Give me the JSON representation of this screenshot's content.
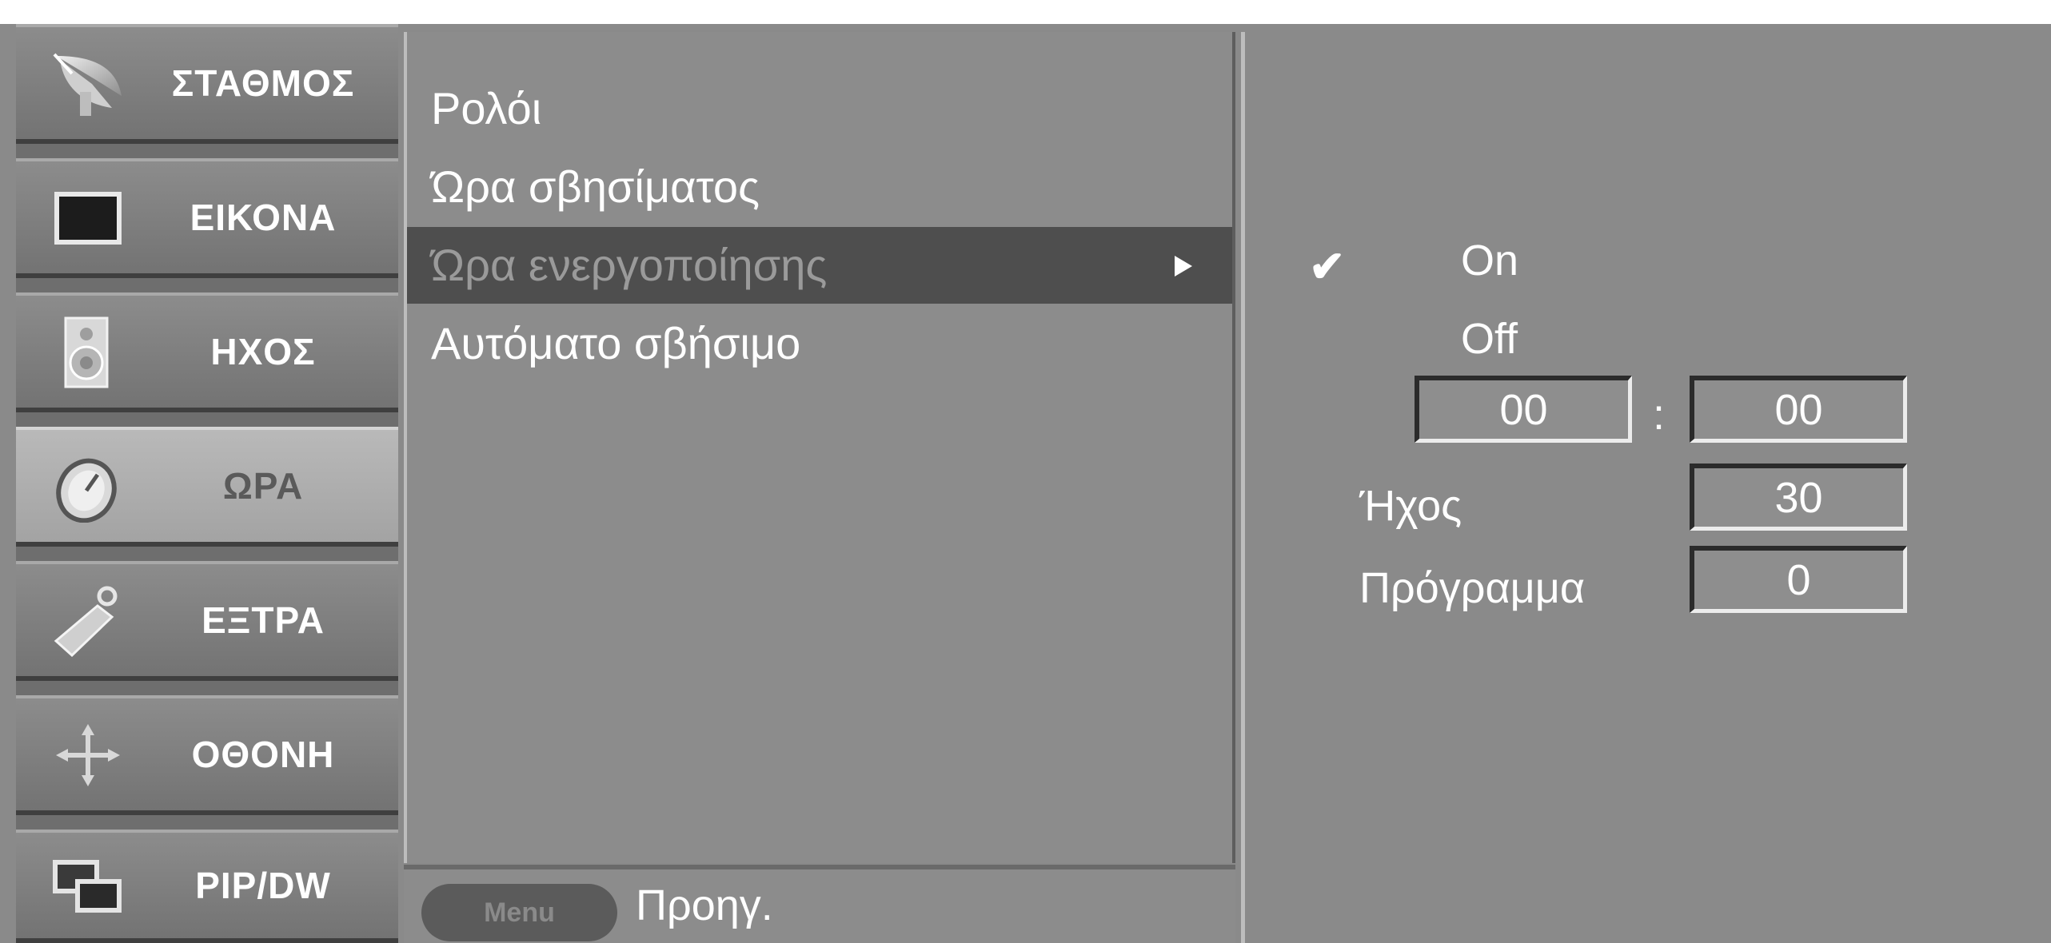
{
  "categories": [
    {
      "label": "ΣΤΑΘΜΟΣ",
      "icon": "satellite-dish-icon"
    },
    {
      "label": "ΕΙΚΟΝΑ",
      "icon": "screen-icon"
    },
    {
      "label": "ΗΧΟΣ",
      "icon": "speaker-icon"
    },
    {
      "label": "ΩΡΑ",
      "icon": "clock-icon"
    },
    {
      "label": "ΕΞΤΡΑ",
      "icon": "key-tag-icon"
    },
    {
      "label": "ΟΘΟΝΗ",
      "icon": "move-arrows-icon"
    },
    {
      "label": "PIP/DW",
      "icon": "pip-windows-icon"
    }
  ],
  "active_category": "ΩΡΑ",
  "submenu": {
    "items": [
      {
        "label": "Ρολόι"
      },
      {
        "label": "Ώρα σβησίματος"
      },
      {
        "label": "Ώρα ενεργοποίησης"
      },
      {
        "label": "Αυτόματο σβήσιμο"
      }
    ],
    "selected": "Ώρα ενεργοποίησης"
  },
  "footer": {
    "menu_button": "Menu",
    "label": "Προηγ."
  },
  "options": {
    "on": "On",
    "off": "Off",
    "checked": "On",
    "hour": "00",
    "separator": ":",
    "minute": "00",
    "volume_label": "Ήχος",
    "volume_value": "30",
    "program_label": "Πρόγραμμα",
    "program_value": "0"
  },
  "colors": {
    "panel": "#8a8a8a",
    "selected_row": "#4e4e4e",
    "text": "#ffffff"
  }
}
